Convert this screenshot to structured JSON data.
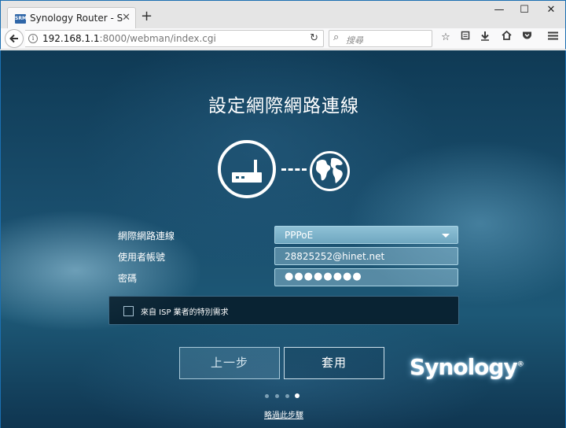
{
  "browser": {
    "tab_title": "Synology Router - Synol…",
    "tab_close": "✕",
    "new_tab": "+",
    "window_controls": {
      "minimize": "—",
      "maximize": "☐",
      "close": "✕"
    },
    "url_host": "192.168.1.1",
    "url_rest": ":8000/webman/index.cgi",
    "search_placeholder": "搜尋",
    "favicon_text": "SRM",
    "icons": [
      "back-arrow-icon",
      "info-icon",
      "reload-icon",
      "search-icon",
      "star-icon",
      "reading-list-icon",
      "download-icon",
      "home-icon",
      "pocket-icon",
      "menu-icon"
    ]
  },
  "setup": {
    "title": "設定網際網路連線",
    "fields": {
      "connection_label": "網際網路連線",
      "connection_value": "PPPoE",
      "username_label": "使用者帳號",
      "username_value": "28825252@hinet.net",
      "password_label": "密碼",
      "password_value": "●●●●●●●●"
    },
    "isp_checkbox_label": "來自 ISP 業者的特別需求",
    "isp_checked": false,
    "buttons": {
      "prev": "上一步",
      "apply": "套用"
    },
    "brand": "Synology",
    "brand_mark": "®",
    "steps": {
      "total": 4,
      "current": 4
    },
    "skip_link": "略過此步驟"
  },
  "colors": {
    "titlebar": "#e5e5e5",
    "accent_border": "#1b6fb1",
    "background_dark": "#0f3a55",
    "input_fill": "#8fc1d6"
  }
}
